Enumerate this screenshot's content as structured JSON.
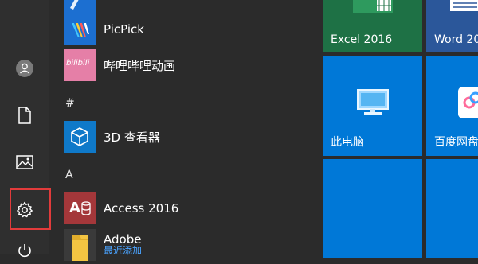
{
  "apps": [
    {
      "name": "PicPick"
    },
    {
      "name": "哔哩哔哩动画",
      "icon_text": "bilibili"
    },
    {
      "name": "3D 查看器"
    },
    {
      "name": "Access 2016",
      "icon_text": "A"
    },
    {
      "name": "Adobe",
      "sub": "最近添加"
    }
  ],
  "letters": {
    "hash": "#",
    "a": "A"
  },
  "tiles": [
    {
      "label": "Excel 2016",
      "color": "#1e7145"
    },
    {
      "label": "Word 20",
      "color": "#2b579a"
    },
    {
      "label": "此电脑",
      "color": "#0078d7"
    },
    {
      "label": "百度网盘",
      "color": "#0078d7"
    }
  ],
  "accents": {
    "highlight_border": "#e23b3b",
    "tile_blue": "#0078d7"
  }
}
